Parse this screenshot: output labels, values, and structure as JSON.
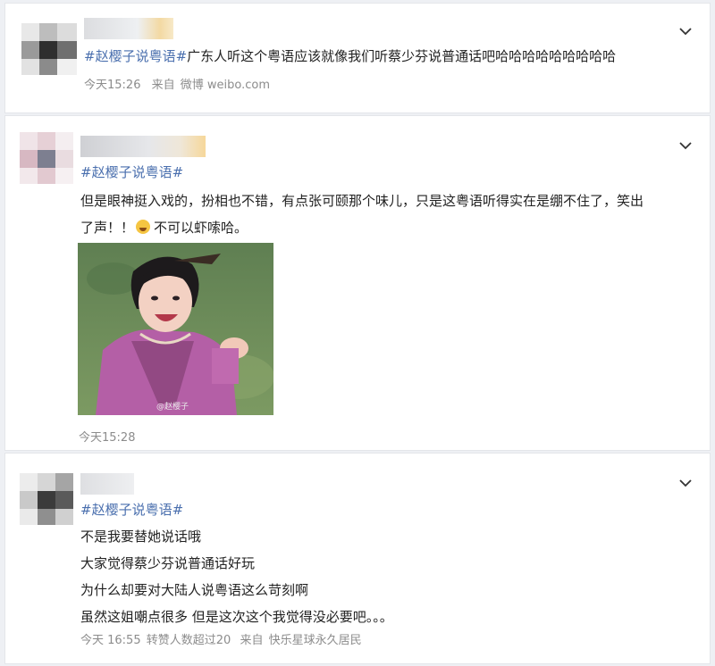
{
  "post1": {
    "hashtag": "#赵樱子说粤语#",
    "text": "广东人听这个粤语应该就像我们听蔡少芬说普通话吧哈哈哈哈哈哈哈哈哈",
    "time": "今天15:26",
    "source_prefix": "来自",
    "source": "微博 weibo.com"
  },
  "post2": {
    "hashtag": "#赵樱子说粤语#",
    "line1": "但是眼神挺入戏的，扮相也不错，有点张可颐那个味儿，只是这粤语听得实在是绷不住了，笑出",
    "line2_prefix": "了声！！",
    "line2_suffix": "不可以虾嗦哈。",
    "image_watermark": "@赵樱子",
    "time": "今天15:28"
  },
  "post3": {
    "hashtag": "#赵樱子说粤语#",
    "lines": [
      "不是我要替她说话哦",
      "大家觉得蔡少芬说普通话好玩",
      "为什么却要对大陆人说粤语这么苛刻啊",
      "虽然这姐嘲点很多 但是这次这个我觉得没必要吧。。。"
    ],
    "time": "今天 16:55",
    "reposts": "转赞人数超过20",
    "source_prefix": "来自",
    "source": "快乐星球永久居民"
  },
  "icons": {
    "expand": "chevron-down-icon",
    "emoji": "laughing-tears-emoji-icon"
  },
  "colors": {
    "hashtag": "#4a6fae",
    "meta": "#8c8c8c",
    "card_bg": "#ffffff",
    "page_bg": "#eef0f4"
  }
}
